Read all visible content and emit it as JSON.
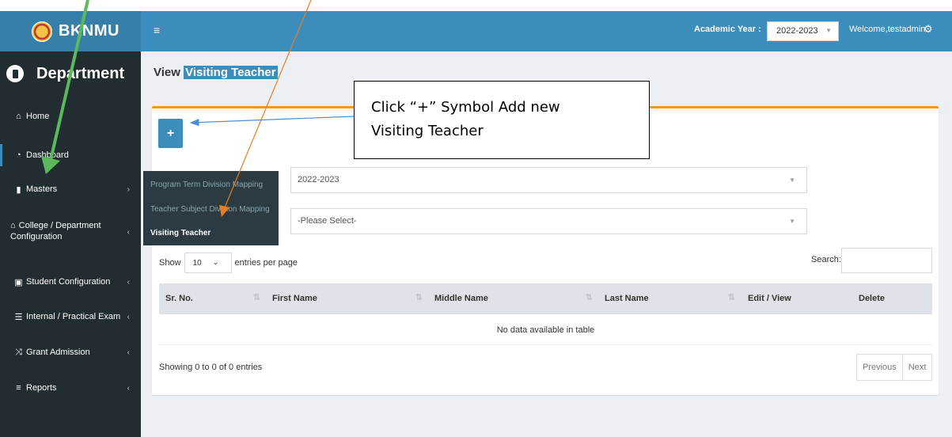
{
  "brand": {
    "name": "BKNMU"
  },
  "sidebar": {
    "section_title": "Department",
    "items": [
      {
        "label": "Home",
        "icon": "home-icon"
      },
      {
        "label": "Dashboard",
        "icon": "dashboard-icon"
      },
      {
        "label": "Masters",
        "icon": "book-icon"
      },
      {
        "label": "College / Department Configuration",
        "icon": "bank-icon"
      },
      {
        "label": "Student Configuration",
        "icon": "id-card-icon"
      },
      {
        "label": "Internal / Practical Exam",
        "icon": "list-icon"
      },
      {
        "label": "Grant Admission",
        "icon": "random-icon"
      },
      {
        "label": "Reports",
        "icon": "bars-icon"
      }
    ]
  },
  "flyout": {
    "items": [
      "Program Term Division Mapping",
      "Teacher Subject Division Mapping",
      "Visiting Teacher"
    ]
  },
  "header": {
    "academic_year_label": "Academic Year :",
    "academic_year_value": "2022-2023",
    "welcome": "Welcome,testadmin"
  },
  "page": {
    "title_prefix": "View",
    "title_highlight": "Visiting Teacher"
  },
  "form": {
    "year_select": "2022-2023",
    "program_select": "-Please Select-"
  },
  "table": {
    "show_label": "Show",
    "length_value": "10",
    "entries_label": "entries per page",
    "search_label": "Search:",
    "columns": [
      "Sr. No.",
      "First Name",
      "Middle Name",
      "Last Name",
      "Edit / View",
      "Delete"
    ],
    "empty_text": "No data available in table",
    "info": "Showing 0 to 0 of 0 entries",
    "prev": "Previous",
    "next": "Next"
  },
  "annotation": {
    "line1": "Click “+” Symbol Add new",
    "line2": "Visiting Teacher"
  },
  "colors": {
    "header": "#3c8dbc",
    "sidebar": "#222d32",
    "box_border": "#f39c12",
    "arrow_green": "#5cb85c",
    "arrow_orange": "#e67e22",
    "arrow_blue": "#4a90d9"
  }
}
